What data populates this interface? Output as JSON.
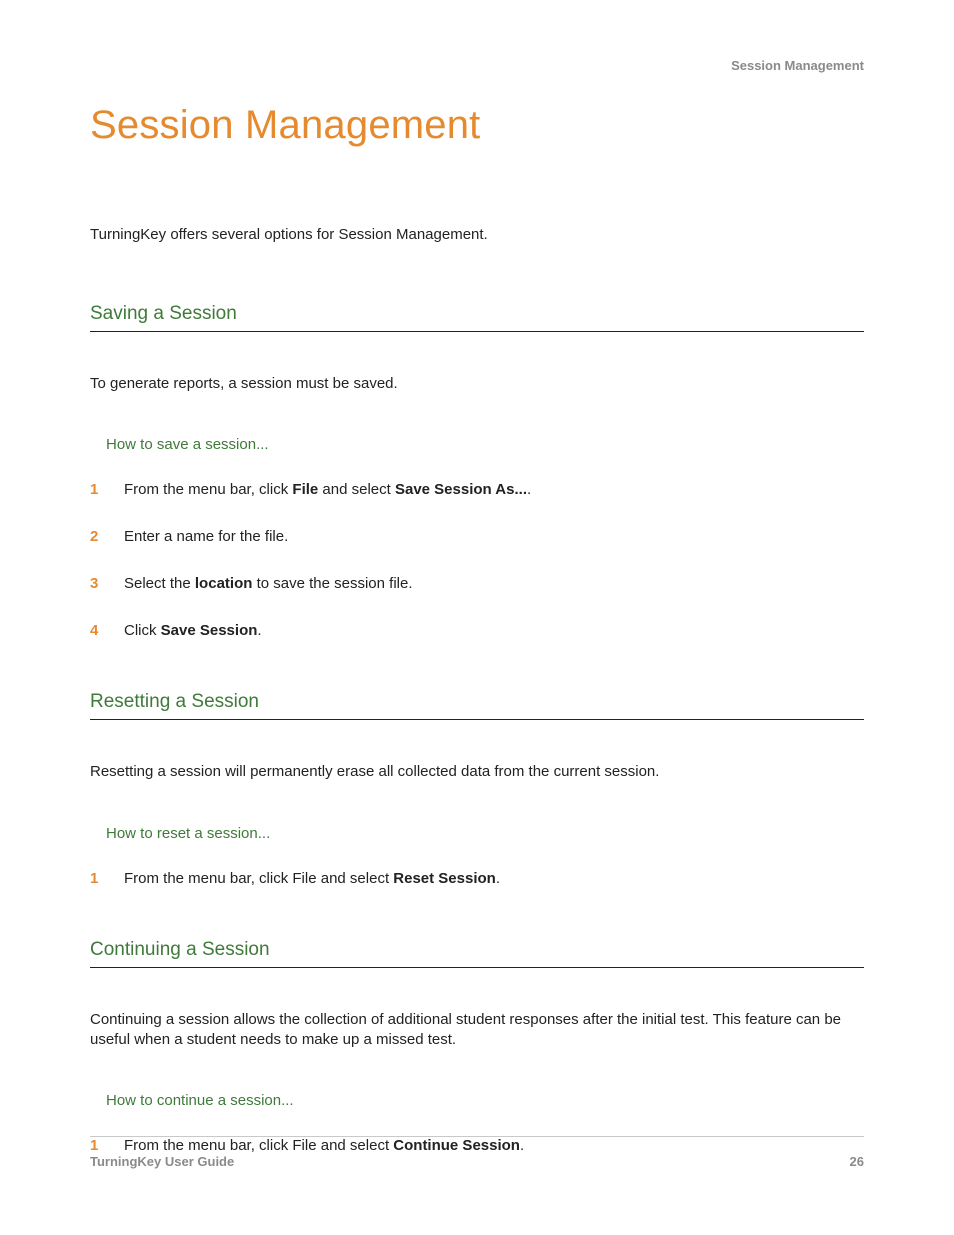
{
  "running_head": "Session Management",
  "title": "Session Management",
  "intro": "TurningKey offers several options for Session Management.",
  "sections": [
    {
      "heading": "Saving a Session",
      "body": "To generate reports, a session must be saved.",
      "howto": "How to save a session...",
      "steps": [
        {
          "n": "1",
          "html": "From the menu bar, click <b>File</b> and select <b>Save Session As...</b>."
        },
        {
          "n": "2",
          "html": "Enter a name for the file."
        },
        {
          "n": "3",
          "html": "Select the <b>location</b> to save the session file."
        },
        {
          "n": "4",
          "html": "Click <b>Save Session</b>."
        }
      ]
    },
    {
      "heading": "Resetting a Session",
      "body": "Resetting a session will permanently erase all collected data from the current session.",
      "howto": "How to reset a session...",
      "steps": [
        {
          "n": "1",
          "html": "From the menu bar, click File and select <b>Reset Session</b>."
        }
      ]
    },
    {
      "heading": "Continuing a Session",
      "body": "Continuing a session allows the collection of additional student responses after the initial test. This feature can be useful when a student needs to make up a missed test.",
      "howto": "How to continue a session...",
      "steps": [
        {
          "n": "1",
          "html": "From the menu bar, click File and select <b>Continue Session</b>."
        }
      ]
    }
  ],
  "footer": {
    "left": "TurningKey User Guide",
    "right": "26"
  }
}
